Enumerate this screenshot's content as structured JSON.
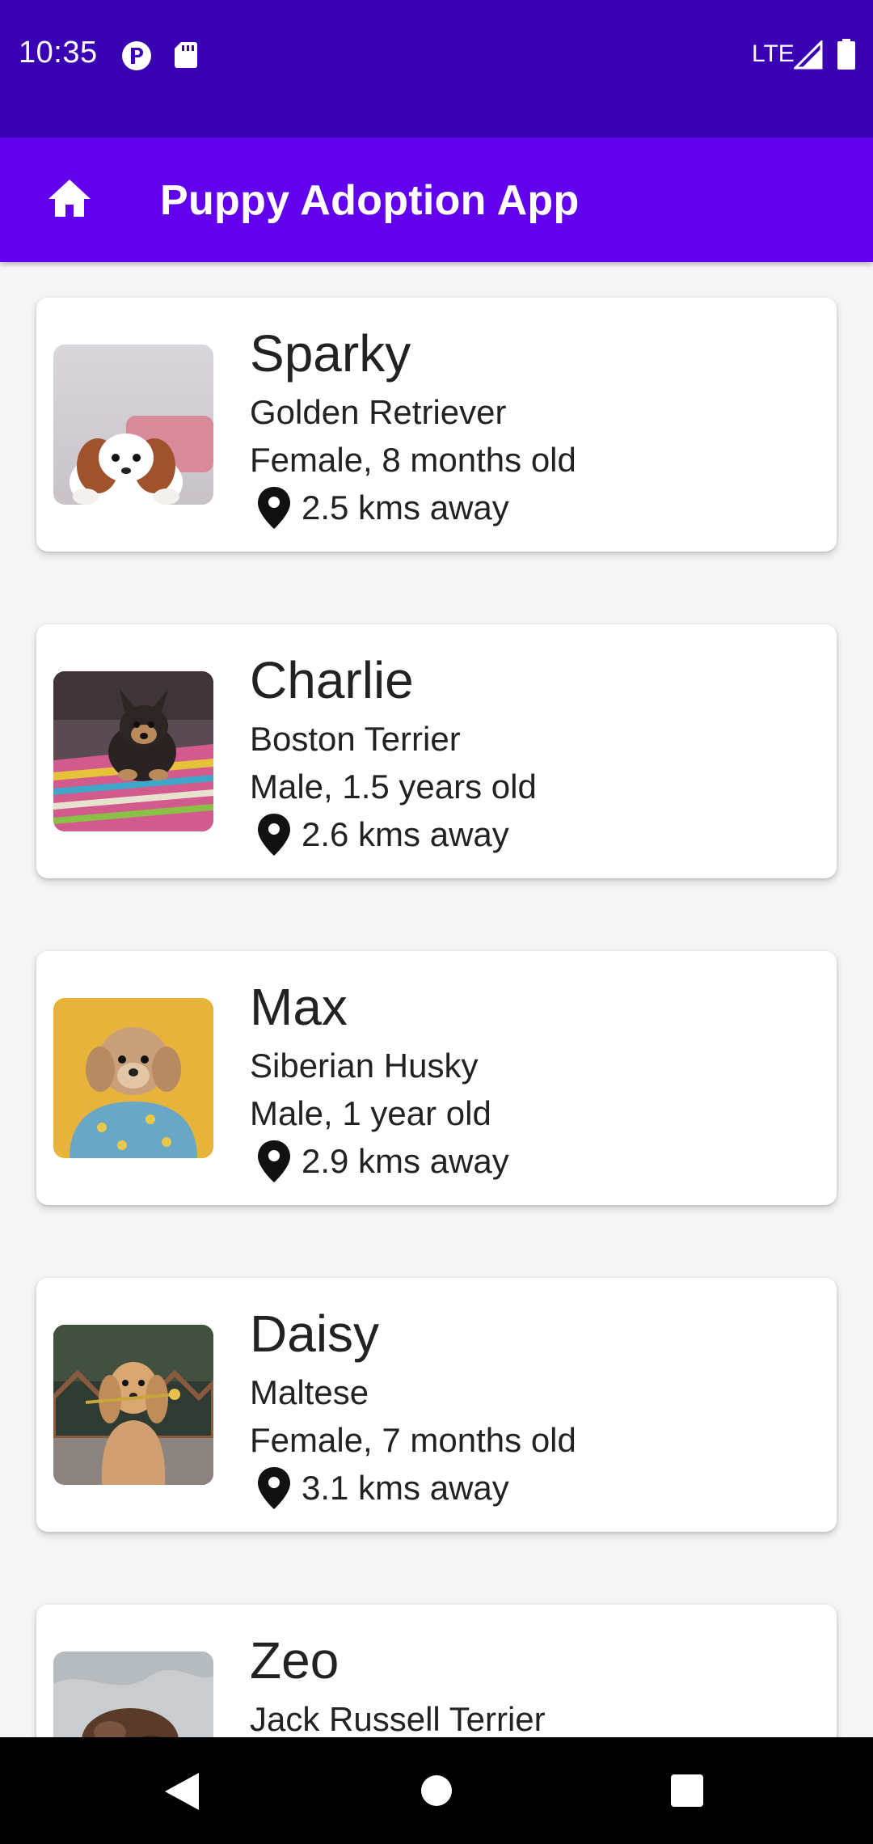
{
  "status_bar": {
    "time": "10:35",
    "network": "LTE",
    "icons": [
      "app-p-icon",
      "sd-card-icon",
      "signal-icon",
      "battery-icon"
    ]
  },
  "app_bar": {
    "title": "Puppy Adoption App",
    "nav_icon": "home-icon"
  },
  "puppies": [
    {
      "name": "Sparky",
      "breed": "Golden Retriever",
      "info": "Female, 8 months old",
      "distance": "2.5 kms away",
      "photo": "puppy-photo-spaniel"
    },
    {
      "name": "Charlie",
      "breed": "Boston Terrier",
      "info": "Male, 1.5 years old",
      "distance": "2.6 kms away",
      "photo": "puppy-photo-yorkie"
    },
    {
      "name": "Max",
      "breed": "Siberian Husky",
      "info": "Male, 1 year old",
      "distance": "2.9 kms away",
      "photo": "puppy-photo-poodle"
    },
    {
      "name": "Daisy",
      "breed": "Maltese",
      "info": "Female, 7 months old",
      "distance": "3.1 kms away",
      "photo": "puppy-photo-retriever"
    },
    {
      "name": "Zeo",
      "breed": "Jack Russell Terrier",
      "info": "",
      "distance": "",
      "photo": "puppy-photo-sleeping"
    }
  ],
  "nav_bar": {
    "icons": [
      "back-icon",
      "home-circle-icon",
      "recents-icon"
    ]
  },
  "colors": {
    "status_bar": "#3a00b3",
    "app_bar": "#6200ee",
    "background": "#f6f6f6",
    "card": "#ffffff",
    "text": "#222222"
  }
}
